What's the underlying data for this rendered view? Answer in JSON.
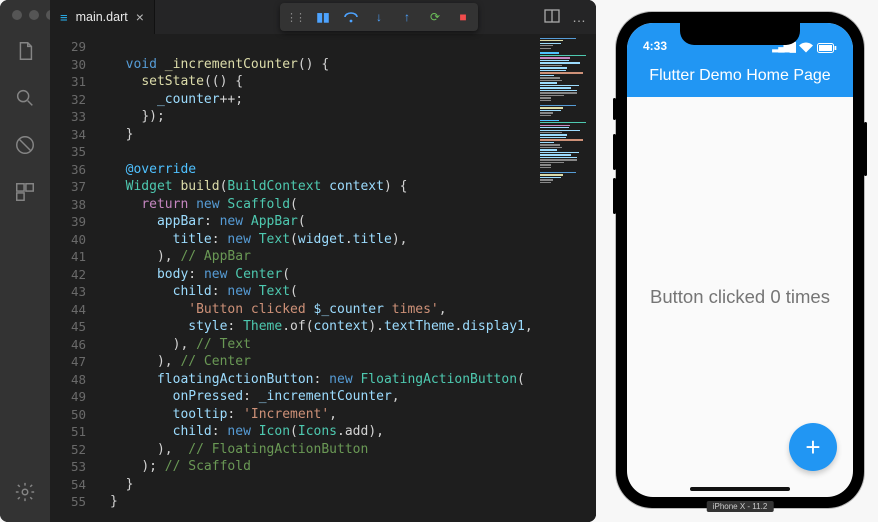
{
  "editor": {
    "tab": {
      "filename": "main.dart",
      "close_glyph": "×"
    },
    "toolbar": {
      "pause": "pause",
      "step_over": "step-over",
      "step_into": "step-into",
      "step_out": "step-out",
      "restart": "restart",
      "stop": "stop"
    },
    "title_actions": {
      "split": "split-editor",
      "more": "…"
    },
    "line_start": 29,
    "lines": [
      "",
      "  void _incrementCounter() {",
      "    setState(() {",
      "      _counter++;",
      "    });",
      "  }",
      "",
      "  @override",
      "  Widget build(BuildContext context) {",
      "    return new Scaffold(",
      "      appBar: new AppBar(",
      "        title: new Text(widget.title),",
      "      ), // AppBar",
      "      body: new Center(",
      "        child: new Text(",
      "          'Button clicked $_counter times',",
      "          style: Theme.of(context).textTheme.display1,",
      "        ), // Text",
      "      ), // Center",
      "      floatingActionButton: new FloatingActionButton(",
      "        onPressed: _incrementCounter,",
      "        tooltip: 'Increment',",
      "        child: new Icon(Icons.add),",
      "      ),  // FloatingActionButton",
      "    ); // Scaffold",
      "  }",
      "}"
    ],
    "tokens": [
      [],
      [
        [
          "kw2",
          "void"
        ],
        [
          "op",
          " "
        ],
        [
          "fn",
          "_incrementCounter"
        ],
        [
          "op",
          "() {"
        ]
      ],
      [
        [
          "fn",
          "setState"
        ],
        [
          "op",
          "(() {"
        ]
      ],
      [
        [
          "id",
          "_counter"
        ],
        [
          "op",
          "++;"
        ]
      ],
      [
        [
          "op",
          "});"
        ]
      ],
      [
        [
          "op",
          "}"
        ]
      ],
      [],
      [
        [
          "meta",
          "@override"
        ]
      ],
      [
        [
          "typ",
          "Widget"
        ],
        [
          "op",
          " "
        ],
        [
          "fn",
          "build"
        ],
        [
          "op",
          "("
        ],
        [
          "typ",
          "BuildContext"
        ],
        [
          "op",
          " "
        ],
        [
          "id",
          "context"
        ],
        [
          "op",
          ") {"
        ]
      ],
      [
        [
          "kw",
          "return"
        ],
        [
          "op",
          " "
        ],
        [
          "kw2",
          "new"
        ],
        [
          "op",
          " "
        ],
        [
          "typ",
          "Scaffold"
        ],
        [
          "op",
          "("
        ]
      ],
      [
        [
          "id",
          "appBar"
        ],
        [
          "op",
          ": "
        ],
        [
          "kw2",
          "new"
        ],
        [
          "op",
          " "
        ],
        [
          "typ",
          "AppBar"
        ],
        [
          "op",
          "("
        ]
      ],
      [
        [
          "id",
          "title"
        ],
        [
          "op",
          ": "
        ],
        [
          "kw2",
          "new"
        ],
        [
          "op",
          " "
        ],
        [
          "typ",
          "Text"
        ],
        [
          "op",
          "("
        ],
        [
          "id",
          "widget"
        ],
        [
          "op",
          "."
        ],
        [
          "id",
          "title"
        ],
        [
          "op",
          "),"
        ]
      ],
      [
        [
          "op",
          "), "
        ],
        [
          "cm",
          "// AppBar"
        ]
      ],
      [
        [
          "id",
          "body"
        ],
        [
          "op",
          ": "
        ],
        [
          "kw2",
          "new"
        ],
        [
          "op",
          " "
        ],
        [
          "typ",
          "Center"
        ],
        [
          "op",
          "("
        ]
      ],
      [
        [
          "id",
          "child"
        ],
        [
          "op",
          ": "
        ],
        [
          "kw2",
          "new"
        ],
        [
          "op",
          " "
        ],
        [
          "typ",
          "Text"
        ],
        [
          "op",
          "("
        ]
      ],
      [
        [
          "str",
          "'Button clicked "
        ],
        [
          "id",
          "$_counter"
        ],
        [
          "str",
          " times'"
        ],
        [
          "op",
          ","
        ]
      ],
      [
        [
          "id",
          "style"
        ],
        [
          "op",
          ": "
        ],
        [
          "typ",
          "Theme"
        ],
        [
          "op",
          ".of("
        ],
        [
          "id",
          "context"
        ],
        [
          "op",
          ")."
        ],
        [
          "id",
          "textTheme"
        ],
        [
          "op",
          "."
        ],
        [
          "id",
          "display1"
        ],
        [
          "op",
          ","
        ]
      ],
      [
        [
          "op",
          "), "
        ],
        [
          "cm",
          "// Text"
        ]
      ],
      [
        [
          "op",
          "), "
        ],
        [
          "cm",
          "// Center"
        ]
      ],
      [
        [
          "id",
          "floatingActionButton"
        ],
        [
          "op",
          ": "
        ],
        [
          "kw2",
          "new"
        ],
        [
          "op",
          " "
        ],
        [
          "typ",
          "FloatingActionButton"
        ],
        [
          "op",
          "("
        ]
      ],
      [
        [
          "id",
          "onPressed"
        ],
        [
          "op",
          ": "
        ],
        [
          "id",
          "_incrementCounter"
        ],
        [
          "op",
          ","
        ]
      ],
      [
        [
          "id",
          "tooltip"
        ],
        [
          "op",
          ": "
        ],
        [
          "str",
          "'Increment'"
        ],
        [
          "op",
          ","
        ]
      ],
      [
        [
          "id",
          "child"
        ],
        [
          "op",
          ": "
        ],
        [
          "kw2",
          "new"
        ],
        [
          "op",
          " "
        ],
        [
          "typ",
          "Icon"
        ],
        [
          "op",
          "("
        ],
        [
          "typ",
          "Icons"
        ],
        [
          "op",
          ".add),"
        ]
      ],
      [
        [
          "op",
          "),  "
        ],
        [
          "cm",
          "// FloatingActionButton"
        ]
      ],
      [
        [
          "op",
          "); "
        ],
        [
          "cm",
          "// Scaffold"
        ]
      ],
      [
        [
          "op",
          "}"
        ]
      ],
      [
        [
          "op",
          "}"
        ]
      ]
    ],
    "indents": [
      0,
      2,
      4,
      6,
      4,
      2,
      0,
      2,
      2,
      4,
      6,
      8,
      6,
      6,
      8,
      10,
      10,
      8,
      6,
      6,
      8,
      8,
      8,
      6,
      4,
      2,
      0
    ]
  },
  "phone": {
    "status": {
      "time": "4:33",
      "signal": "▮▮▮▮",
      "wifi": "wifi",
      "battery": "▬"
    },
    "appbar_title": "Flutter Demo Home Page",
    "body_text": "Button clicked 0 times",
    "fab_glyph": "+",
    "device_label": "iPhone X - 11.2"
  },
  "colors": {
    "accent": "#2196f3"
  }
}
